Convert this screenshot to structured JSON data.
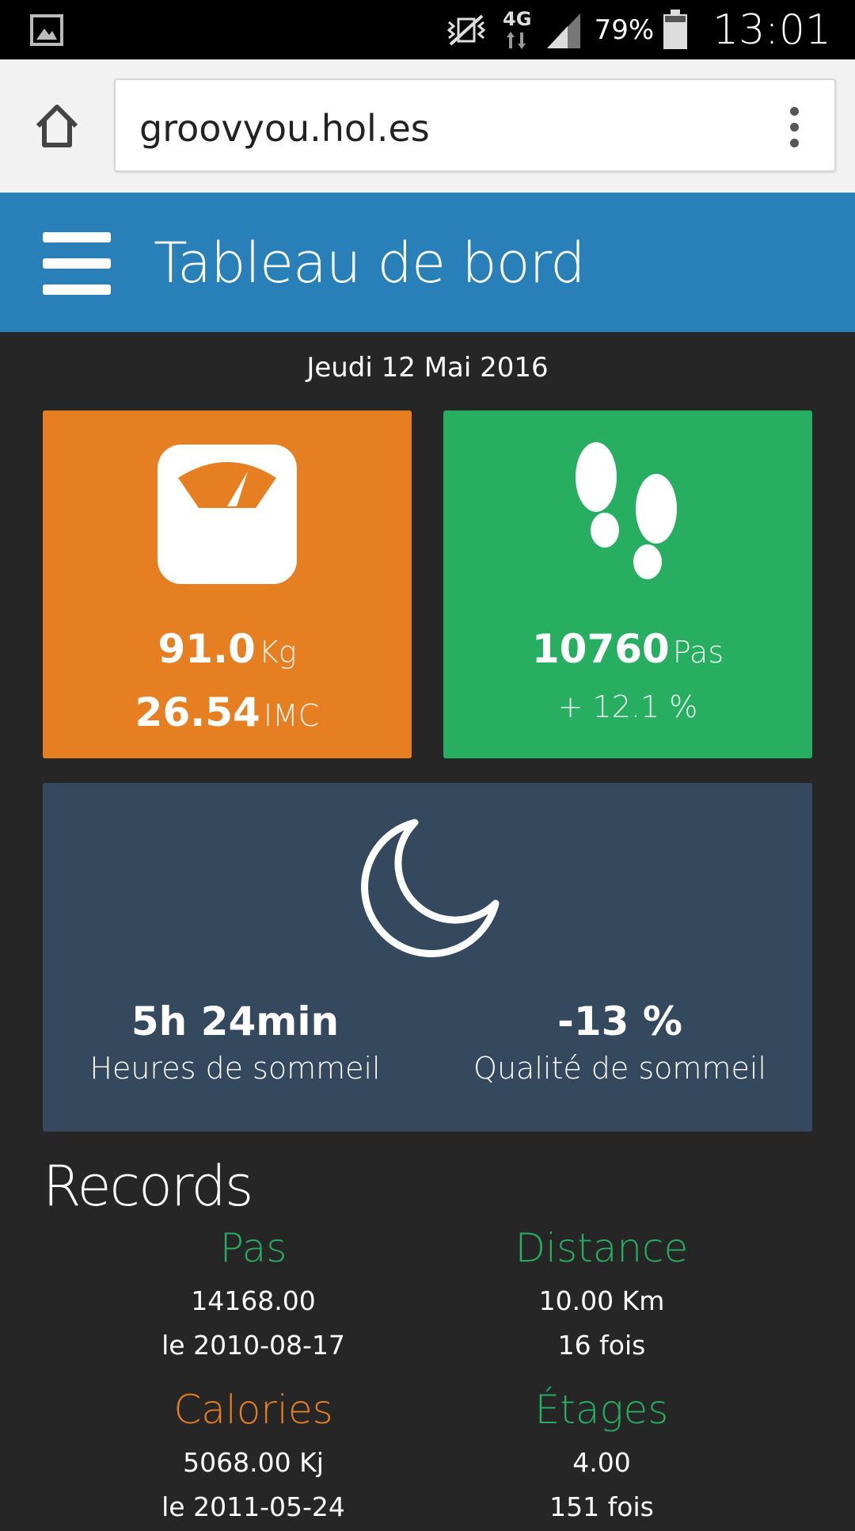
{
  "status_bar": {
    "battery_percent": "79%",
    "time": "13:01",
    "network": "4G",
    "icons": [
      "gallery-icon",
      "vibrate-mute-icon",
      "data-4g-icon",
      "signal-icon",
      "battery-icon"
    ]
  },
  "browser": {
    "url": "groovyou.hol.es"
  },
  "header": {
    "title": "Tableau de bord"
  },
  "date": "Jeudi 12 Mai 2016",
  "weight_tile": {
    "weight": "91.0",
    "weight_unit": "Kg",
    "bmi": "26.54",
    "bmi_unit": "IMC",
    "color": "#e67e22"
  },
  "steps_tile": {
    "steps": "10760",
    "steps_unit": "Pas",
    "change": "+ 12.1 %",
    "color": "#27ae60"
  },
  "sleep_tile": {
    "hours": "5h 24min",
    "hours_label": "Heures de sommeil",
    "quality": "-13 %",
    "quality_label": "Qualité de sommeil",
    "color": "#34495e"
  },
  "records": {
    "title": "Records",
    "items": [
      {
        "label": "Pas",
        "value": "14168.00",
        "detail": "le 2010-08-17",
        "color": "#27ae60"
      },
      {
        "label": "Distance",
        "value": "10.00 Km",
        "detail": "16 fois",
        "color": "#27ae60"
      },
      {
        "label": "Calories",
        "value": "5068.00 Kj",
        "detail": "le 2011-05-24",
        "color": "#e67e22"
      },
      {
        "label": "Étages",
        "value": "4.00",
        "detail": "151 fois",
        "color": "#27ae60"
      }
    ]
  }
}
